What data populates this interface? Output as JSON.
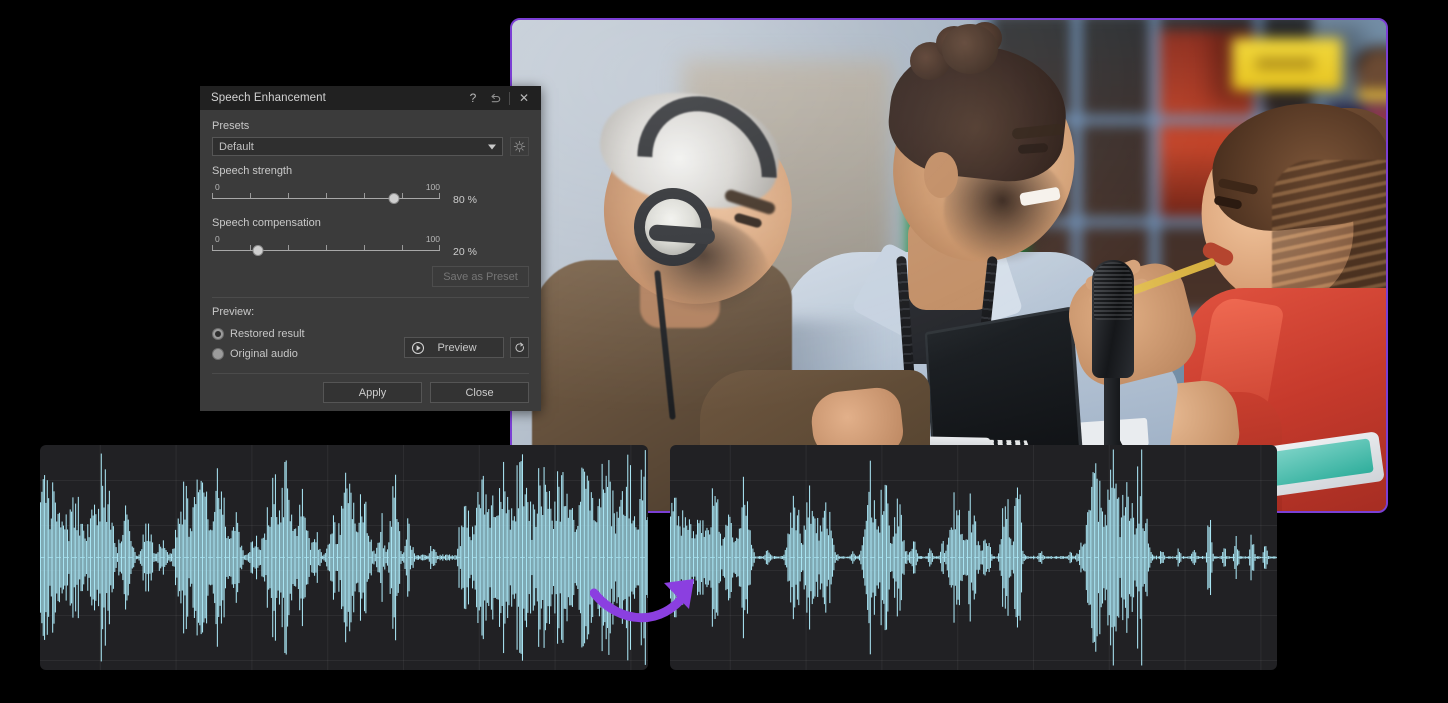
{
  "dialog": {
    "title": "Speech Enhancement",
    "titlebar": {
      "help_icon": "question-mark-icon",
      "reset_icon": "undo-arrow-icon",
      "close_icon": "close-x-icon",
      "help_label": "?",
      "close_label": "✕"
    },
    "presets": {
      "label": "Presets",
      "selected": "Default",
      "options": [
        "Default"
      ],
      "gear_icon": "gear-icon"
    },
    "speech_strength": {
      "label": "Speech strength",
      "min_label": "0",
      "max_label": "100",
      "value": 80,
      "value_label": "80 %"
    },
    "speech_compensation": {
      "label": "Speech compensation",
      "min_label": "0",
      "max_label": "100",
      "value": 20,
      "value_label": "20 %"
    },
    "save_as_preset_label": "Save as Preset",
    "preview": {
      "label": "Preview:",
      "options": [
        {
          "label": "Restored result",
          "selected": true
        },
        {
          "label": "Original audio",
          "selected": false
        }
      ],
      "button_label": "Preview",
      "play_icon": "play-circle-icon",
      "replay_icon": "replay-circular-arrow-icon"
    },
    "footer": {
      "apply_label": "Apply",
      "close_label": "Close"
    }
  },
  "waveforms": {
    "left": {
      "name": "original-waveform",
      "color": "#A8E4F2"
    },
    "right": {
      "name": "enhanced-waveform",
      "color": "#A8E4F2"
    },
    "arrow": {
      "name": "transform-arrow",
      "color": "#8B3FE0"
    }
  },
  "photo": {
    "alt": "Three podcasters talking at an outdoor cafe table with a microphone, laptop and headphones",
    "border_color": "#7B3FD4"
  },
  "colors": {
    "dialog_body": "#3b3b3b",
    "dialog_titlebar": "#212121",
    "waveform_panel": "#212124",
    "accent_purple": "#8B3FE0",
    "waveform_cyan": "#A8E4F2"
  }
}
